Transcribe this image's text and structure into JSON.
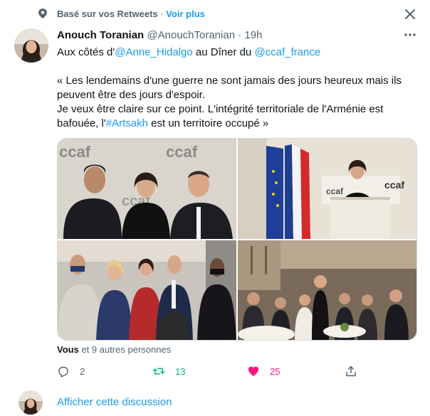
{
  "context": {
    "label": "Basé sur vos Retweets",
    "separator": "·",
    "see_more": "Voir plus"
  },
  "tweet": {
    "author_name": "Anouch Toranian",
    "handle": "@AnouchToranian",
    "dot": "·",
    "time": "19h",
    "line1_prefix": "Aux côtés d'",
    "mention1": "@Anne_Hidalgo",
    "line1_mid": " au Dîner du ",
    "mention2": "@ccaf_france",
    "quote_line1": "« Les lendemains d'une guerre ne sont jamais des jours heureux mais ils",
    "quote_line2": "peuvent être des jours d'espoir.",
    "quote_line3": "Je veux être claire sur ce point. L'intégrité territoriale de l'Arménie est",
    "quote_line4_prefix": "bafouée, l'",
    "hashtag": "#Artsakh",
    "quote_line4_suffix": " est un territoire occupé »",
    "photo_logo_text": "ccaf",
    "liked_by_bold": "Vous",
    "liked_by_rest": " et 9 autres personnes"
  },
  "actions": {
    "reply_count": "2",
    "retweet_count": "13",
    "like_count": "25"
  },
  "footer": {
    "show_thread": "Afficher cette discussion"
  },
  "icons": {
    "context": "location-pin-icon",
    "close": "close-icon",
    "more": "more-horizontal-icon",
    "reply": "reply-icon",
    "retweet": "retweet-icon",
    "like": "heart-icon",
    "share": "share-icon"
  },
  "colors": {
    "link_blue": "#1d9bf0",
    "retweet_green": "#00ba7c",
    "like_pink": "#f91880",
    "secondary_text": "#536471"
  }
}
